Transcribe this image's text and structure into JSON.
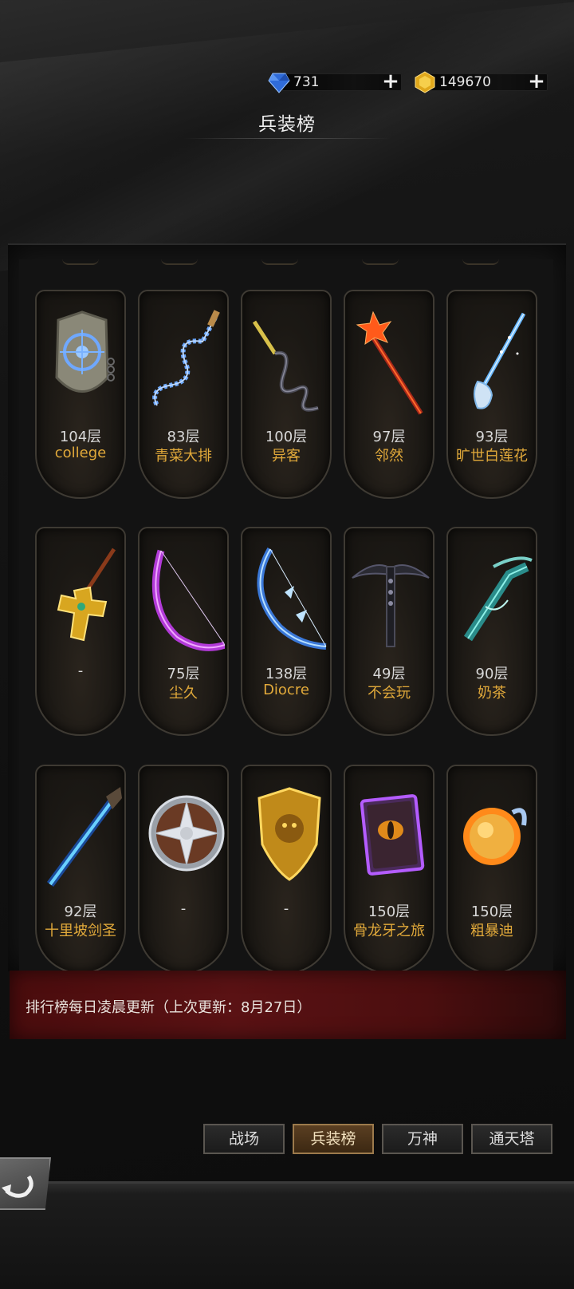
{
  "currency": {
    "diamond": {
      "value": "731",
      "icon": "blue-gem-icon"
    },
    "gold": {
      "value": "149670",
      "icon": "gold-gem-icon"
    }
  },
  "page": {
    "title": "兵装榜"
  },
  "rankings": [
    {
      "floor": "104层",
      "name": "college",
      "weapon": "shield-icon"
    },
    {
      "floor": "83层",
      "name": "青菜大排",
      "weapon": "chain-whip-icon"
    },
    {
      "floor": "100层",
      "name": "异客",
      "weapon": "whip-icon"
    },
    {
      "floor": "97层",
      "name": "邻然",
      "weapon": "flame-staff-icon"
    },
    {
      "floor": "93层",
      "name": "旷世白莲花",
      "weapon": "frost-staff-icon"
    },
    {
      "floor": "-",
      "name": "",
      "weapon": "golden-cross-icon"
    },
    {
      "floor": "75层",
      "name": "尘久",
      "weapon": "purple-bow-icon"
    },
    {
      "floor": "138层",
      "name": "Diocre",
      "weapon": "ice-bow-icon"
    },
    {
      "floor": "49层",
      "name": "不会玩",
      "weapon": "dark-crossbow-icon"
    },
    {
      "floor": "90层",
      "name": "奶茶",
      "weapon": "frost-crossbow-icon"
    },
    {
      "floor": "92层",
      "name": "十里坡剑圣",
      "weapon": "rifle-icon"
    },
    {
      "floor": "-",
      "name": "",
      "weapon": "round-shield-icon"
    },
    {
      "floor": "-",
      "name": "",
      "weapon": "golden-shield-icon"
    },
    {
      "floor": "150层",
      "name": "骨龙牙之旅",
      "weapon": "eye-tome-icon"
    },
    {
      "floor": "150层",
      "name": "粗暴迪",
      "weapon": "fire-orb-icon"
    }
  ],
  "notice": "排行榜每日凌晨更新（上次更新：8月27日）",
  "tabs": [
    {
      "label": "战场",
      "active": false
    },
    {
      "label": "兵装榜",
      "active": true
    },
    {
      "label": "万神",
      "active": false
    },
    {
      "label": "通天塔",
      "active": false
    }
  ],
  "colors": {
    "accent": "#e1a93a",
    "banner": "#5a1214"
  }
}
